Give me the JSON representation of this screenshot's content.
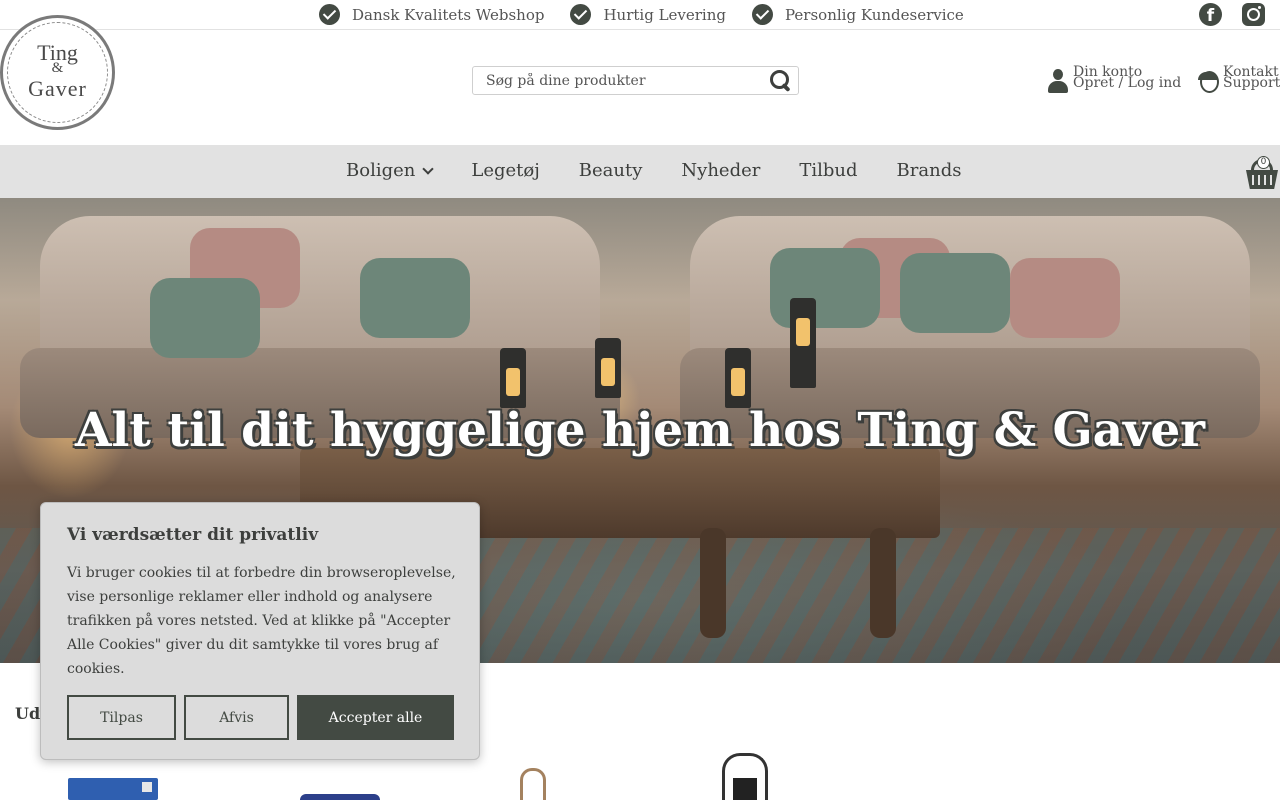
{
  "usp": {
    "items": [
      {
        "icon": "check-circle-icon",
        "label": "Dansk Kvalitets Webshop"
      },
      {
        "icon": "check-circle-icon",
        "label": "Hurtig Levering"
      },
      {
        "icon": "check-circle-icon",
        "label": "Personlig Kundeservice"
      }
    ],
    "social": [
      {
        "icon": "facebook-icon",
        "glyph": "f"
      },
      {
        "icon": "instagram-icon"
      }
    ]
  },
  "logo": {
    "line1": "Ting",
    "line2": "&",
    "line3": "Gaver"
  },
  "search": {
    "placeholder": "Søg på dine produkter",
    "value": "",
    "icon": "search-icon"
  },
  "account": {
    "line1": "Din konto",
    "line2": "Opret / Log ind",
    "icon": "user-icon"
  },
  "support": {
    "line1": "Kontakt",
    "line2": "Support",
    "icon": "headset-icon"
  },
  "nav": {
    "items": [
      {
        "label": "Boligen",
        "has_dropdown": true
      },
      {
        "label": "Legetøj"
      },
      {
        "label": "Beauty"
      },
      {
        "label": "Nyheder"
      },
      {
        "label": "Tilbud"
      },
      {
        "label": "Brands"
      }
    ],
    "cart": {
      "icon": "basket-icon",
      "count": "0"
    }
  },
  "hero": {
    "title": "Alt til dit hyggelige hjem hos Ting & Gaver"
  },
  "section": {
    "label": "Udv"
  },
  "cookie": {
    "title": "Vi værdsætter dit privatliv",
    "text": "Vi bruger cookies til at forbedre din browseroplevelse, vise personlige reklamer eller indhold og analysere trafikken på vores netsted. Ved at klikke på \"Accepter Alle Cookies\" giver du dit samtykke til vores brug af cookies.",
    "buttons": {
      "customize": "Tilpas",
      "reject": "Afvis",
      "accept": "Accepter alle"
    }
  },
  "colors": {
    "accent": "#434a43",
    "nav_bg": "#e2e2e2",
    "banner_bg": "#dcdcdc"
  }
}
